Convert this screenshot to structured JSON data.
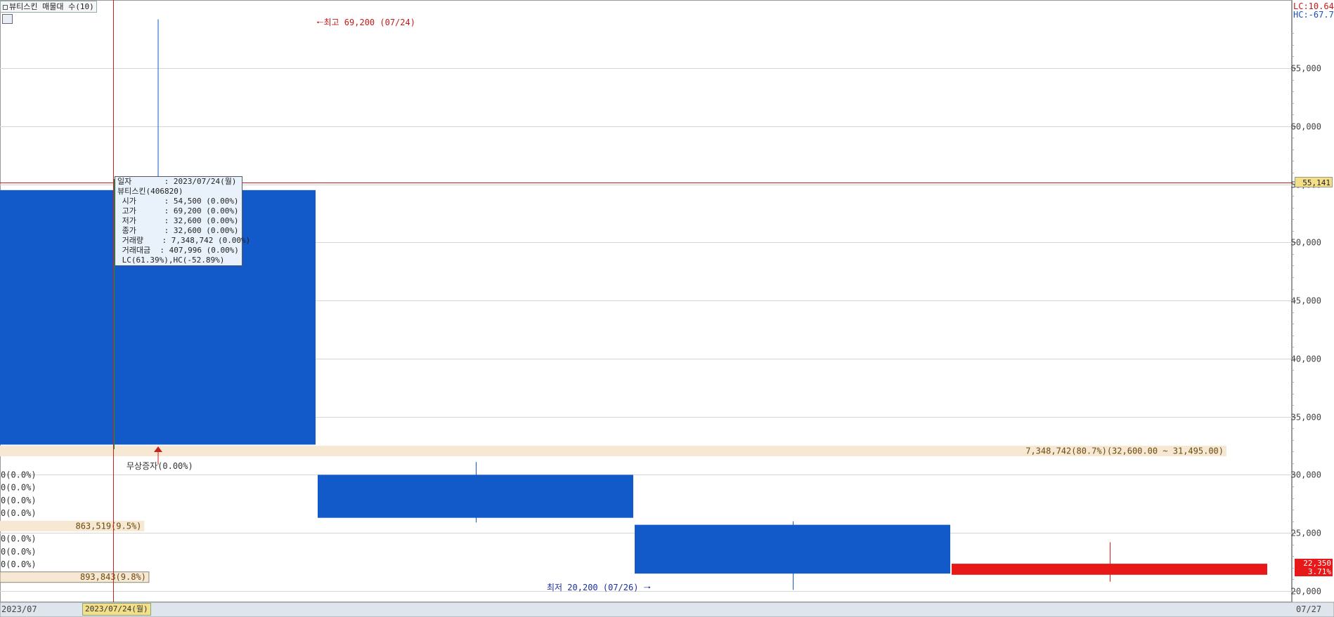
{
  "window": {
    "title": "뷰티스킨 매물대 수(10)",
    "lc": "LC:10.64",
    "hc": "HC:-67.70"
  },
  "chart_data": {
    "type": "candlestick",
    "y_axis_ticks": [
      20000,
      25000,
      30000,
      35000,
      40000,
      45000,
      50000,
      55000,
      60000,
      65000
    ],
    "y_axis_tick_labels": [
      "20,000",
      "25,000",
      "30,000",
      "35,000",
      "40,000",
      "45,000",
      "50,000",
      "55,000",
      "60,000",
      "65,000"
    ],
    "ylim": [
      19500,
      70500
    ],
    "x_labels": {
      "start": "2023/07",
      "end": "07/27",
      "cursor": "2023/07/24(월)"
    },
    "candles": [
      {
        "open": 54500,
        "high": 69200,
        "low": 32600,
        "close": 32600,
        "color": "#1259c9"
      },
      {
        "open": 30000,
        "high": 31100,
        "low": 25900,
        "close": 26300,
        "color": "#1259c9"
      },
      {
        "open": 25700,
        "high": 26000,
        "low": 20100,
        "close": 21500,
        "color": "#1259c9"
      },
      {
        "open": 21400,
        "high": 24200,
        "low": 20800,
        "close": 22350,
        "color": "#e81818"
      }
    ],
    "current_price_line": {
      "value": 55141,
      "label": "55,141"
    },
    "last_price": {
      "label": "22,350",
      "pct": "3.71%"
    },
    "annotations": {
      "high": "최고 69,200 (07/24)",
      "low": "최저 20,200 (07/26)"
    },
    "volume_profile": [
      {
        "label": "893,843(9.8%)",
        "value": 893843,
        "pct": 9.8,
        "price": 21195
      },
      {
        "label": "0(0.0%)",
        "value": 0,
        "pct": 0,
        "price": 22295
      },
      {
        "label": "0(0.0%)",
        "value": 0,
        "pct": 0,
        "price": 23395
      },
      {
        "label": "0(0.0%)",
        "value": 0,
        "pct": 0,
        "price": 24495
      },
      {
        "label": "863,519(9.5%)",
        "value": 863519,
        "pct": 9.5,
        "price": 25595
      },
      {
        "label": "0(0.0%)",
        "value": 0,
        "pct": 0,
        "price": 26695
      },
      {
        "label": "0(0.0%)",
        "value": 0,
        "pct": 0,
        "price": 27795
      },
      {
        "label": "0(0.0%)",
        "value": 0,
        "pct": 0,
        "price": 28895
      },
      {
        "label": "0(0.0%)",
        "value": 0,
        "pct": 0,
        "price": 29995
      },
      {
        "label": "7,348,742(80.7%)(32,600.00 ~ 31,495.00)",
        "value": 7348742,
        "pct": 80.7,
        "price": 32050
      }
    ],
    "event_marker": "무상증자(0.00%)"
  },
  "tooltip": {
    "lines": [
      "일자       : 2023/07/24(월)",
      "뷰티스킨(406820)",
      " 시가      : 54,500 (0.00%)",
      " 고가      : 69,200 (0.00%)",
      " 저가      : 32,600 (0.00%)",
      " 종가      : 32,600 (0.00%)",
      " 거래량    : 7,348,742 (0.00%)",
      " 거래대금  : 407,996 (0.00%)",
      " LC(61.39%),HC(-52.89%)"
    ]
  }
}
